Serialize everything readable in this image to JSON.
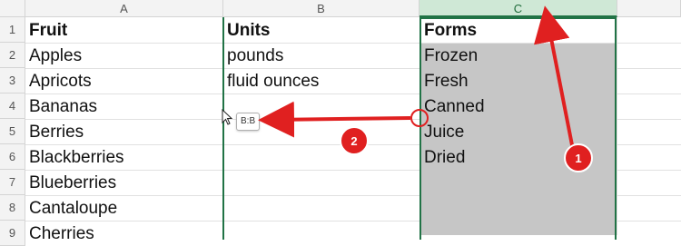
{
  "columns": [
    "A",
    "B",
    "C"
  ],
  "rows": [
    "1",
    "2",
    "3",
    "4",
    "5",
    "6",
    "7",
    "8",
    "9"
  ],
  "col_a": [
    "Fruit",
    "Apples",
    "Apricots",
    "Bananas",
    "Berries",
    "Blackberries",
    "Blueberries",
    "Cantaloupe",
    "Cherries"
  ],
  "col_b": [
    "Units",
    "pounds",
    "fluid ounces"
  ],
  "col_c": [
    "Forms",
    "Frozen",
    "Fresh",
    "Canned",
    "Juice",
    "Dried"
  ],
  "drag_tooltip": "B:B",
  "annotations": [
    "1",
    "2"
  ],
  "colors": {
    "selection_border": "#217346",
    "selection_fill": "#c6c6c6",
    "selected_header": "#cfe8d6",
    "annotation_red": "#e02020"
  },
  "icons": [
    "mouse-pointer-icon"
  ]
}
